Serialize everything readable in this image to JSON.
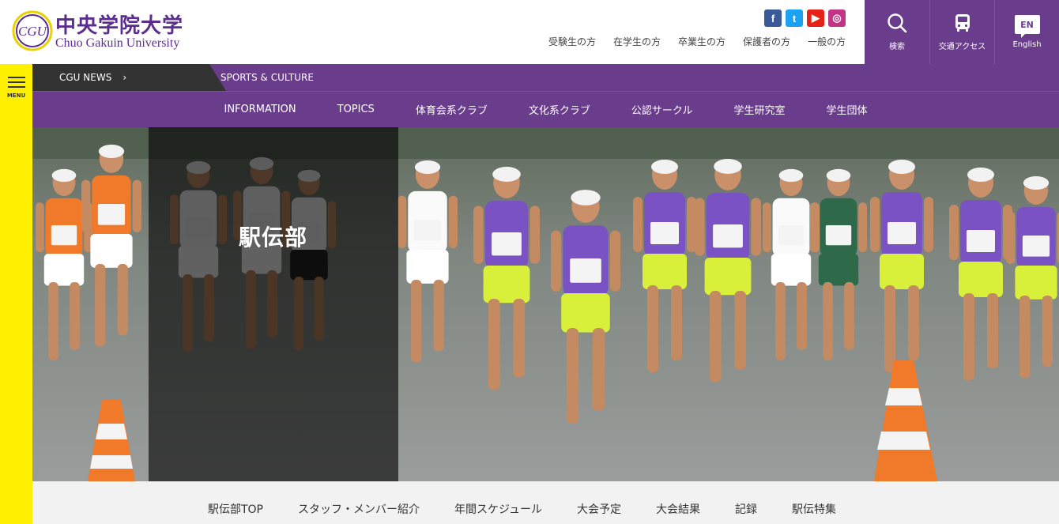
{
  "header": {
    "logo_jp": "中央学院大学",
    "logo_en": "Chuo Gakuin University",
    "logo_emblem": "CGU",
    "social": [
      {
        "name": "facebook",
        "glyph": "f",
        "color": "#3b5998"
      },
      {
        "name": "twitter",
        "glyph": "t",
        "color": "#1da1f2"
      },
      {
        "name": "youtube",
        "glyph": "▶",
        "color": "#e62117"
      },
      {
        "name": "instagram",
        "glyph": "◎",
        "color": "#c13584"
      }
    ],
    "audience_links": [
      "受験生の方",
      "在学生の方",
      "卒業生の方",
      "保護者の方",
      "一般の方"
    ],
    "tools": {
      "search_label": "検索",
      "access_label": "交通アクセス",
      "english_label": "English",
      "english_badge": "EN"
    }
  },
  "menu": {
    "label": "MENU"
  },
  "breadcrumb": {
    "news": "CGU NEWS",
    "separator": "›",
    "current": "SPORTS & CULTURE"
  },
  "subnav": [
    "INFORMATION",
    "TOPICS",
    "体育会系クラブ",
    "文化系クラブ",
    "公認サークル",
    "学生研究室",
    "学生団体"
  ],
  "hero": {
    "title": "駅伝部"
  },
  "bottom_nav": {
    "items": [
      "駅伝部TOP",
      "スタッフ・メンバー紹介",
      "年間スケジュール",
      "大会予定",
      "大会結果",
      "記録",
      "駅伝特集"
    ],
    "active_index": 0
  },
  "colors": {
    "brand_purple": "#6a3d8c",
    "menu_yellow": "#fff000",
    "news_dark": "#333333"
  }
}
